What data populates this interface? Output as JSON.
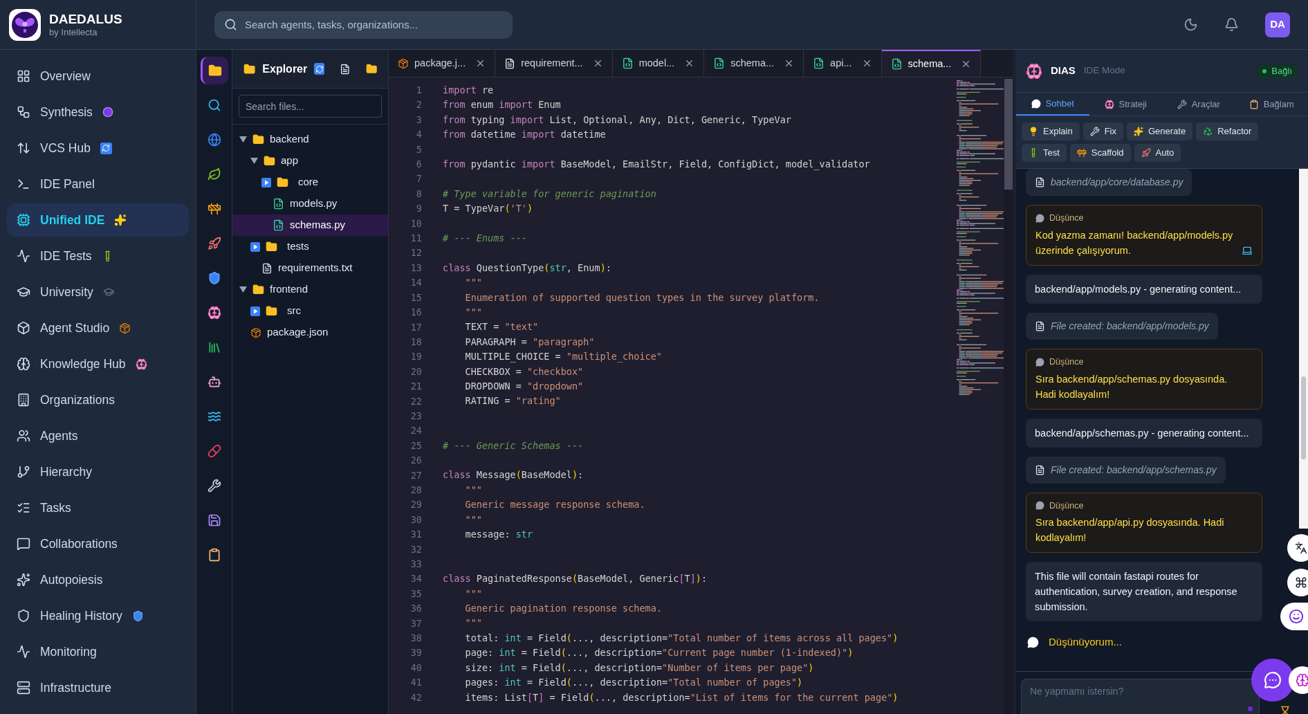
{
  "brand": {
    "title": "DAEDALUS",
    "subtitle": "by Intellecta"
  },
  "nav": [
    {
      "label": "Overview",
      "selected": false
    },
    {
      "label": "Synthesis",
      "selected": false
    },
    {
      "label": "VCS Hub",
      "selected": false
    },
    {
      "label": "IDE Panel",
      "selected": false
    },
    {
      "label": "Unified IDE",
      "selected": true
    },
    {
      "label": "IDE Tests",
      "selected": false
    },
    {
      "label": "University",
      "selected": false
    },
    {
      "label": "Agent Studio",
      "selected": false
    },
    {
      "label": "Knowledge Hub",
      "selected": false
    },
    {
      "label": "Organizations",
      "selected": false
    },
    {
      "label": "Agents",
      "selected": false
    },
    {
      "label": "Hierarchy",
      "selected": false
    },
    {
      "label": "Tasks",
      "selected": false
    },
    {
      "label": "Collaborations",
      "selected": false
    },
    {
      "label": "Autopoiesis",
      "selected": false
    },
    {
      "label": "Healing History",
      "selected": false
    },
    {
      "label": "Monitoring",
      "selected": false
    },
    {
      "label": "Infrastructure",
      "selected": false
    }
  ],
  "topbar": {
    "search": {
      "placeholder": "Search agents, tasks, organizations..."
    },
    "avatar": "DA"
  },
  "activity_bar": [
    {
      "selected": true
    },
    {
      "selected": false
    },
    {
      "selected": false
    },
    {
      "selected": false
    },
    {
      "selected": false
    },
    {
      "selected": false
    },
    {
      "selected": false
    },
    {
      "selected": false
    },
    {
      "selected": false
    },
    {
      "selected": false
    },
    {
      "selected": false
    },
    {
      "selected": false
    },
    {
      "selected": false
    },
    {
      "selected": false
    },
    {
      "selected": false
    }
  ],
  "explorer": {
    "title": "Explorer",
    "search": {
      "placeholder": "Search files..."
    },
    "tree": [
      {
        "name": "backend",
        "kind": "folder",
        "expanded": true,
        "selected": false,
        "children": [
          {
            "name": "app",
            "kind": "folder",
            "expanded": true,
            "selected": false,
            "children": [
              {
                "name": "core",
                "kind": "folder",
                "expanded": false,
                "selected": false
              },
              {
                "name": "models.py",
                "kind": "python",
                "selected": false
              },
              {
                "name": "schemas.py",
                "kind": "python",
                "selected": true
              }
            ]
          },
          {
            "name": "tests",
            "kind": "folder",
            "expanded": false,
            "selected": false
          },
          {
            "name": "requirements.txt",
            "kind": "text",
            "selected": false
          }
        ]
      },
      {
        "name": "frontend",
        "kind": "folder",
        "expanded": true,
        "selected": false,
        "children": [
          {
            "name": "src",
            "kind": "folder",
            "expanded": false,
            "selected": false
          }
        ]
      },
      {
        "name": "package.json",
        "kind": "package",
        "selected": false
      }
    ]
  },
  "editor_tabs": [
    {
      "label": "package.j...",
      "kind": "package",
      "selected": false
    },
    {
      "label": "requirement...",
      "kind": "text",
      "selected": false
    },
    {
      "label": "model...",
      "kind": "python",
      "selected": false
    },
    {
      "label": "schema...",
      "kind": "python",
      "selected": false
    },
    {
      "label": "api...",
      "kind": "python",
      "selected": false
    },
    {
      "label": "schema...",
      "kind": "python",
      "selected": true
    }
  ],
  "code": [
    {
      "number": "1",
      "tokens": [
        {
          "text": "import",
          "kind": "keyword"
        },
        {
          "text": " re",
          "kind": "plain"
        }
      ]
    },
    {
      "number": "2",
      "tokens": [
        {
          "text": "from",
          "kind": "keyword"
        },
        {
          "text": " enum ",
          "kind": "plain"
        },
        {
          "text": "import",
          "kind": "keyword"
        },
        {
          "text": " Enum",
          "kind": "plain"
        }
      ]
    },
    {
      "number": "3",
      "tokens": [
        {
          "text": "from",
          "kind": "keyword"
        },
        {
          "text": " typing ",
          "kind": "plain"
        },
        {
          "text": "import",
          "kind": "keyword"
        },
        {
          "text": " List, Optional, Any, Dict, Generic, TypeVar",
          "kind": "plain"
        }
      ]
    },
    {
      "number": "4",
      "tokens": [
        {
          "text": "from",
          "kind": "keyword"
        },
        {
          "text": " datetime ",
          "kind": "plain"
        },
        {
          "text": "import",
          "kind": "keyword"
        },
        {
          "text": " datetime",
          "kind": "plain"
        }
      ]
    },
    {
      "number": "5"
    },
    {
      "number": "6",
      "tokens": [
        {
          "text": "from",
          "kind": "keyword"
        },
        {
          "text": " pydantic ",
          "kind": "plain"
        },
        {
          "text": "import",
          "kind": "keyword"
        },
        {
          "text": " BaseModel, EmailStr, Field, ConfigDict, model_validator",
          "kind": "plain"
        }
      ]
    },
    {
      "number": "7"
    },
    {
      "number": "8",
      "tokens": [
        {
          "text": "# Type variable for generic pagination",
          "kind": "comment"
        }
      ]
    },
    {
      "number": "9",
      "tokens": [
        {
          "text": "T = TypeVar",
          "kind": "plain"
        },
        {
          "text": "(",
          "kind": "paren"
        },
        {
          "text": "'T'",
          "kind": "string"
        },
        {
          "text": ")",
          "kind": "paren"
        }
      ]
    },
    {
      "number": "10"
    },
    {
      "number": "11",
      "tokens": [
        {
          "text": "# --- Enums ---",
          "kind": "comment"
        }
      ]
    },
    {
      "number": "12"
    },
    {
      "number": "13",
      "tokens": [
        {
          "text": "class",
          "kind": "keyword"
        },
        {
          "text": " QuestionType",
          "kind": "plain"
        },
        {
          "text": "(",
          "kind": "paren"
        },
        {
          "text": "str",
          "kind": "builtin"
        },
        {
          "text": ", Enum",
          "kind": "plain"
        },
        {
          "text": ")",
          "kind": "paren"
        },
        {
          "text": ":",
          "kind": "plain"
        }
      ]
    },
    {
      "number": "14",
      "tokens": [
        {
          "text": "    \"\"\"",
          "kind": "string"
        }
      ]
    },
    {
      "number": "15",
      "tokens": [
        {
          "text": "    Enumeration of supported question types in the survey platform.",
          "kind": "string"
        }
      ]
    },
    {
      "number": "16",
      "tokens": [
        {
          "text": "    \"\"\"",
          "kind": "string"
        }
      ]
    },
    {
      "number": "17",
      "tokens": [
        {
          "text": "    TEXT = ",
          "kind": "plain"
        },
        {
          "text": "\"text\"",
          "kind": "string"
        }
      ]
    },
    {
      "number": "18",
      "tokens": [
        {
          "text": "    PARAGRAPH = ",
          "kind": "plain"
        },
        {
          "text": "\"paragraph\"",
          "kind": "string"
        }
      ]
    },
    {
      "number": "19",
      "tokens": [
        {
          "text": "    MULTIPLE_CHOICE = ",
          "kind": "plain"
        },
        {
          "text": "\"multiple_choice\"",
          "kind": "string"
        }
      ]
    },
    {
      "number": "20",
      "tokens": [
        {
          "text": "    CHECKBOX = ",
          "kind": "plain"
        },
        {
          "text": "\"checkbox\"",
          "kind": "string"
        }
      ]
    },
    {
      "number": "21",
      "tokens": [
        {
          "text": "    DROPDOWN = ",
          "kind": "plain"
        },
        {
          "text": "\"dropdown\"",
          "kind": "string"
        }
      ]
    },
    {
      "number": "22",
      "tokens": [
        {
          "text": "    RATING = ",
          "kind": "plain"
        },
        {
          "text": "\"rating\"",
          "kind": "string"
        }
      ]
    },
    {
      "number": "23"
    },
    {
      "number": "24"
    },
    {
      "number": "25",
      "tokens": [
        {
          "text": "# --- Generic Schemas ---",
          "kind": "comment"
        }
      ]
    },
    {
      "number": "26"
    },
    {
      "number": "27",
      "tokens": [
        {
          "text": "class",
          "kind": "keyword"
        },
        {
          "text": " Message",
          "kind": "plain"
        },
        {
          "text": "(",
          "kind": "paren"
        },
        {
          "text": "BaseModel",
          "kind": "plain"
        },
        {
          "text": ")",
          "kind": "paren"
        },
        {
          "text": ":",
          "kind": "plain"
        }
      ]
    },
    {
      "number": "28",
      "tokens": [
        {
          "text": "    \"\"\"",
          "kind": "string"
        }
      ]
    },
    {
      "number": "29",
      "tokens": [
        {
          "text": "    Generic message response schema.",
          "kind": "string"
        }
      ]
    },
    {
      "number": "30",
      "tokens": [
        {
          "text": "    \"\"\"",
          "kind": "string"
        }
      ]
    },
    {
      "number": "31",
      "tokens": [
        {
          "text": "    message: ",
          "kind": "plain"
        },
        {
          "text": "str",
          "kind": "builtin"
        }
      ]
    },
    {
      "number": "32"
    },
    {
      "number": "33"
    },
    {
      "number": "34",
      "tokens": [
        {
          "text": "class",
          "kind": "keyword"
        },
        {
          "text": " PaginatedResponse",
          "kind": "plain"
        },
        {
          "text": "(",
          "kind": "paren"
        },
        {
          "text": "BaseModel, Generic",
          "kind": "plain"
        },
        {
          "text": "[",
          "kind": "bracket"
        },
        {
          "text": "T",
          "kind": "plain"
        },
        {
          "text": "]",
          "kind": "bracket"
        },
        {
          "text": ")",
          "kind": "paren"
        },
        {
          "text": ":",
          "kind": "plain"
        }
      ]
    },
    {
      "number": "35",
      "tokens": [
        {
          "text": "    \"\"\"",
          "kind": "string"
        }
      ]
    },
    {
      "number": "36",
      "tokens": [
        {
          "text": "    Generic pagination response schema.",
          "kind": "string"
        }
      ]
    },
    {
      "number": "37",
      "tokens": [
        {
          "text": "    \"\"\"",
          "kind": "string"
        }
      ]
    },
    {
      "number": "38",
      "tokens": [
        {
          "text": "    total: ",
          "kind": "plain"
        },
        {
          "text": "int",
          "kind": "builtin"
        },
        {
          "text": " = Field",
          "kind": "plain"
        },
        {
          "text": "(",
          "kind": "paren"
        },
        {
          "text": "..., description=",
          "kind": "plain"
        },
        {
          "text": "\"Total number of items across all pages\"",
          "kind": "string"
        },
        {
          "text": ")",
          "kind": "paren"
        }
      ]
    },
    {
      "number": "39",
      "tokens": [
        {
          "text": "    page: ",
          "kind": "plain"
        },
        {
          "text": "int",
          "kind": "builtin"
        },
        {
          "text": " = Field",
          "kind": "plain"
        },
        {
          "text": "(",
          "kind": "paren"
        },
        {
          "text": "..., description=",
          "kind": "plain"
        },
        {
          "text": "\"Current page number (1-indexed)\"",
          "kind": "string"
        },
        {
          "text": ")",
          "kind": "paren"
        }
      ]
    },
    {
      "number": "40",
      "tokens": [
        {
          "text": "    size: ",
          "kind": "plain"
        },
        {
          "text": "int",
          "kind": "builtin"
        },
        {
          "text": " = Field",
          "kind": "plain"
        },
        {
          "text": "(",
          "kind": "paren"
        },
        {
          "text": "..., description=",
          "kind": "plain"
        },
        {
          "text": "\"Number of items per page\"",
          "kind": "string"
        },
        {
          "text": ")",
          "kind": "paren"
        }
      ]
    },
    {
      "number": "41",
      "tokens": [
        {
          "text": "    pages: ",
          "kind": "plain"
        },
        {
          "text": "int",
          "kind": "builtin"
        },
        {
          "text": " = Field",
          "kind": "plain"
        },
        {
          "text": "(",
          "kind": "paren"
        },
        {
          "text": "..., description=",
          "kind": "plain"
        },
        {
          "text": "\"Total number of pages\"",
          "kind": "string"
        },
        {
          "text": ")",
          "kind": "paren"
        }
      ]
    },
    {
      "number": "42",
      "tokens": [
        {
          "text": "    items: List",
          "kind": "plain"
        },
        {
          "text": "[",
          "kind": "bracket"
        },
        {
          "text": "T",
          "kind": "plain"
        },
        {
          "text": "]",
          "kind": "bracket"
        },
        {
          "text": " = Field",
          "kind": "plain"
        },
        {
          "text": "(",
          "kind": "paren"
        },
        {
          "text": "..., description=",
          "kind": "plain"
        },
        {
          "text": "\"List of items for the current page\"",
          "kind": "string"
        },
        {
          "text": ")",
          "kind": "paren"
        }
      ]
    }
  ],
  "assistant": {
    "title": "DIAS",
    "mode": "IDE Mode",
    "status": "Bağlı",
    "tabs": [
      {
        "label": "Sohbet",
        "selected": true
      },
      {
        "label": "Strateji",
        "selected": false
      },
      {
        "label": "Araçlar",
        "selected": false
      },
      {
        "label": "Bağlam",
        "selected": false
      }
    ],
    "actions": [
      "Explain",
      "Fix",
      "Generate",
      "Refactor",
      "Test",
      "Scaffold",
      "Auto"
    ],
    "messages": [
      {
        "kind": "file",
        "text": "backend/app/core/database.py"
      },
      {
        "kind": "thought",
        "label": "Düşünce",
        "text": "Kod yazma zamanı! backend/app/models.py üzerinde çalışıyorum."
      },
      {
        "kind": "status",
        "text": "backend/app/models.py - generating content..."
      },
      {
        "kind": "file",
        "text": "File created: backend/app/models.py"
      },
      {
        "kind": "thought",
        "label": "Düşünce",
        "text": "Sıra backend/app/schemas.py dosyasında. Hadi kodlayalım!"
      },
      {
        "kind": "status",
        "text": "backend/app/schemas.py - generating content..."
      },
      {
        "kind": "file",
        "text": "File created: backend/app/schemas.py"
      },
      {
        "kind": "thought",
        "label": "Düşünce",
        "text": "Sıra backend/app/api.py dosyasında. Hadi kodlayalım!"
      },
      {
        "kind": "status",
        "text": "This file will contain fastapi routes for authentication, survey creation, and response submission."
      }
    ],
    "thinking": "Düşünüyorum...",
    "input": {
      "placeholder": "Ne yapmamı istersin?"
    }
  }
}
